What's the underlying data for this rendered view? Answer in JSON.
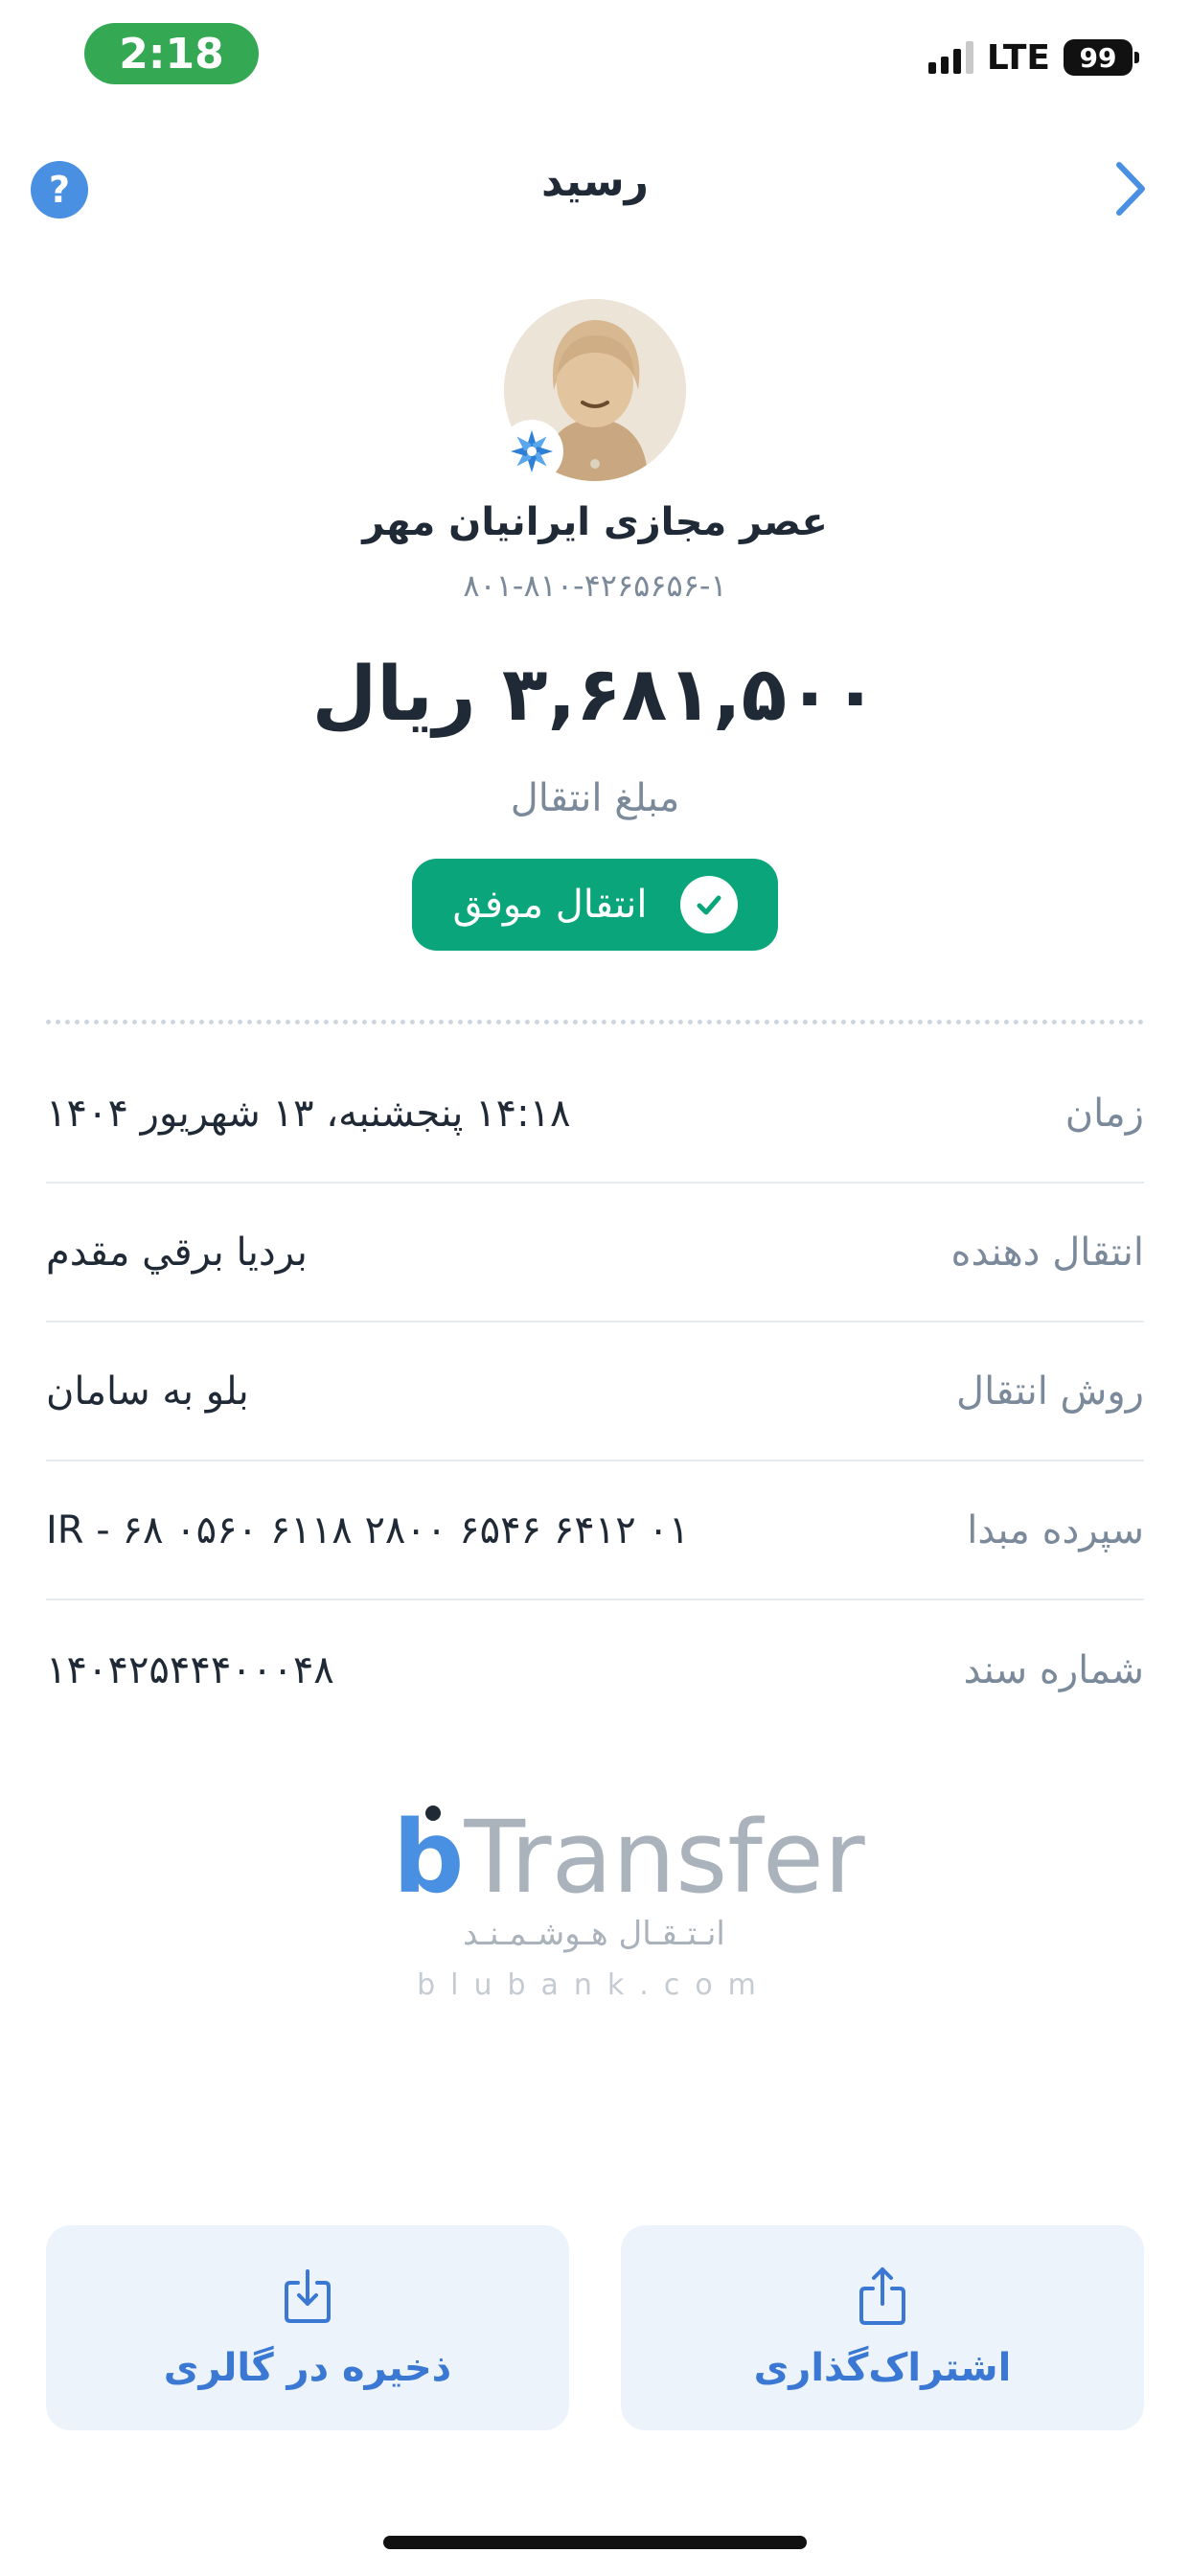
{
  "status_bar": {
    "time": "2:18",
    "network": "LTE",
    "battery": "99"
  },
  "header": {
    "title": "رسید",
    "help_icon": "?"
  },
  "receipt": {
    "merchant_name": "عصر مجازی ایرانیان مهر",
    "merchant_account": "۸۰۱-۸۱۰-۴۲۶۵۶۵۶-۱",
    "amount": "۳,۶۸۱,۵۰۰ ریال",
    "amount_label": "مبلغ انتقال",
    "status": "انتقال موفق",
    "status_color": "#0aa57a"
  },
  "details": [
    {
      "label": "زمان",
      "value": "۱۴:۱۸ پنجشنبه، ۱۳ شهریور ۱۴۰۴"
    },
    {
      "label": "انتقال دهنده",
      "value": "بردیا برقي مقدم"
    },
    {
      "label": "روش انتقال",
      "value": "بلو به سامان"
    },
    {
      "label": "سپرده مبدا",
      "value": "IR - ۶۸ ۰۵۶۰ ۶۱۱۸ ۲۸۰۰ ۶۵۴۶ ۶۴۱۲ ۰۱"
    },
    {
      "label": "شماره سند",
      "value": "۱۴۰۴۲۵۴۴۴۰۰۰۴۸"
    }
  ],
  "branding": {
    "logo_letter": "b",
    "logo_word": "Transfer",
    "tagline": "انـتـقـال هـوشـمـنـد",
    "url": "blubank.com"
  },
  "actions": {
    "save_label": "ذخیره در گالری",
    "share_label": "اشتراک‌گذاری"
  },
  "colors": {
    "accent": "#4a90e2",
    "success": "#0aa57a",
    "button_bg": "#ecf3fb"
  }
}
